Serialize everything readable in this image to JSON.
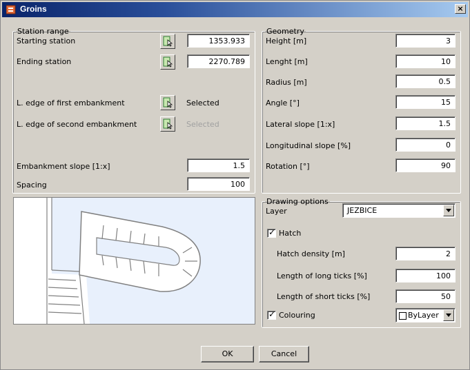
{
  "window": {
    "title": "Groins",
    "close_label": "×"
  },
  "station_range": {
    "legend": "Station range",
    "starting_station": {
      "label": "Starting station",
      "value": "1353.933"
    },
    "ending_station": {
      "label": "Ending station",
      "value": "2270.789"
    },
    "first_embankment": {
      "label": "L. edge of first embankment",
      "status": "Selected"
    },
    "second_embankment": {
      "label": "L. edge of second embankment",
      "status": "Selected"
    },
    "embankment_slope": {
      "label": "Embankment slope [1:x]",
      "value": "1.5"
    },
    "spacing": {
      "label": "Spacing",
      "value": "100"
    }
  },
  "geometry": {
    "legend": "Geometry",
    "fields": [
      {
        "label": "Height [m]",
        "value": "3"
      },
      {
        "label": "Lenght [m]",
        "value": "10"
      },
      {
        "label": "Radius [m]",
        "value": "0.5"
      },
      {
        "label": "Angle [°]",
        "value": "15"
      },
      {
        "label": "Lateral slope [1:x]",
        "value": "1.5"
      },
      {
        "label": "Longitudinal slope [%]",
        "value": "0"
      },
      {
        "label": "Rotation [°]",
        "value": "90"
      }
    ]
  },
  "drawing_options": {
    "legend": "Drawing options",
    "layer_label": "Layer",
    "layer_value": "JEZBICE",
    "hatch_label": "Hatch",
    "hatch_checked": true,
    "hatch_density": {
      "label": "Hatch density [m]",
      "value": "2"
    },
    "long_ticks": {
      "label": "Length of long ticks [%]",
      "value": "100"
    },
    "short_ticks": {
      "label": "Length of short ticks [%]",
      "value": "50"
    },
    "colouring_label": "Colouring",
    "colouring_checked": true,
    "colour_value": "ByLayer"
  },
  "buttons": {
    "ok": "OK",
    "cancel": "Cancel"
  },
  "colors": {
    "title_bar_start": "#0a246a",
    "title_bar_end": "#a6caf0",
    "preview_bg": "#e8f0fc",
    "dialog_bg": "#d4d0c8"
  }
}
